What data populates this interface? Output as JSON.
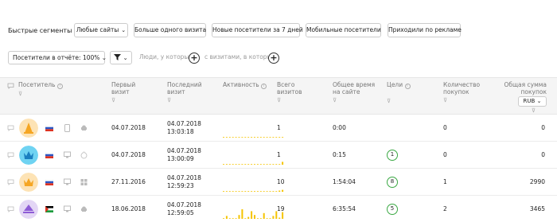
{
  "segments": {
    "label": "Быстрые сегменты",
    "buttons": [
      "Любые сайты",
      "Больше одного визита",
      "Новые посетители за 7 дней",
      "Мобильные посетители",
      "Приходили по рекламе"
    ]
  },
  "filters": {
    "visitors_in_report": "Посетители в отчёте: 100%",
    "people_who": "Люди, у которых",
    "with_visits_where": "с визитами, в которых"
  },
  "table": {
    "headers": {
      "visitor": "Посетитель",
      "first_visit": "Первый визит",
      "last_visit": "Последний визит",
      "activity": "Активность",
      "total_visits": "Всего визитов",
      "total_time": "Общее время на сайте",
      "goals": "Цели",
      "purchases": "Количество покупок",
      "sum": "Общая сумма покупок",
      "currency": "RUB"
    },
    "rows": [
      {
        "first": "04.07.2018",
        "last_date": "04.07.2018",
        "last_time": "13:03:18",
        "visits": "1",
        "time": "0:00",
        "goals": "",
        "purchases": "0",
        "sum": "0",
        "avatar_color": "#fde3b5",
        "icon_color": "#f5a623",
        "spark": [
          0,
          0,
          0,
          0,
          0,
          0,
          0,
          0,
          0,
          0,
          0,
          0,
          0,
          0,
          0,
          0,
          0,
          0,
          0,
          0
        ]
      },
      {
        "first": "04.07.2018",
        "last_date": "04.07.2018",
        "last_time": "13:00:09",
        "visits": "1",
        "time": "0:15",
        "goals": "1",
        "purchases": "0",
        "sum": "0",
        "avatar_color": "#6fd3f2",
        "icon_color": "#1a7fc0",
        "spark": [
          0,
          0,
          0,
          0,
          0,
          0,
          0,
          0,
          0,
          0,
          0,
          0,
          0,
          0,
          0,
          0,
          0,
          0,
          0,
          3
        ]
      },
      {
        "first": "27.11.2016",
        "last_date": "04.07.2018",
        "last_time": "12:59:23",
        "visits": "10",
        "time": "1:54:04",
        "goals": "8",
        "purchases": "1",
        "sum": "2990",
        "avatar_color": "#fde3b5",
        "icon_color": "#f5a623",
        "spark": [
          0,
          0,
          0,
          0,
          0,
          0,
          0,
          0,
          0,
          0,
          0,
          0,
          0,
          0,
          0,
          0,
          0,
          0,
          1,
          2
        ]
      },
      {
        "first": "18.06.2018",
        "last_date": "04.07.2018",
        "last_time": "12:59:05",
        "visits": "19",
        "time": "6:35:54",
        "goals": "5",
        "purchases": "2",
        "sum": "3465",
        "avatar_color": "#e3d6f5",
        "icon_color": "#8e5cd6",
        "spark": [
          0,
          3,
          0,
          0,
          0,
          4,
          10,
          0,
          2,
          8,
          4,
          0,
          0,
          6,
          0,
          0,
          3,
          8,
          1,
          7
        ]
      }
    ]
  },
  "colors": {
    "spark": "#f5c400",
    "goal_ring": "#3aa843",
    "header_bg": "#f5f5f5"
  }
}
